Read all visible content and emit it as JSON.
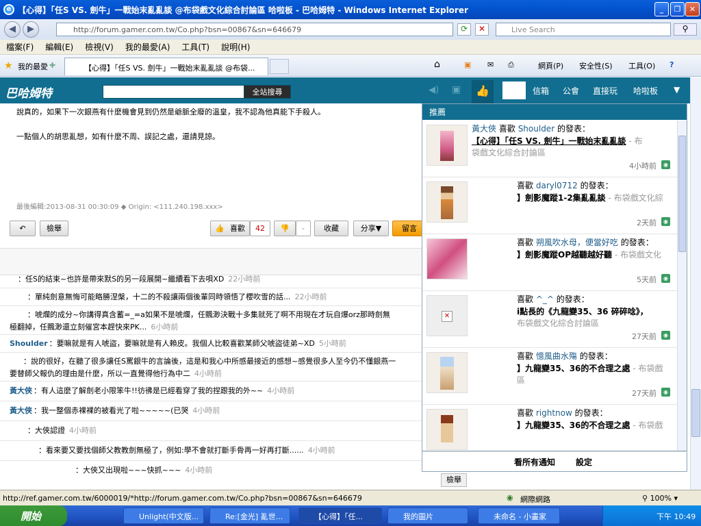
{
  "window": {
    "title": "【心得】「任S VS. 劍牛」一戰始末亂亂談 @布袋戲文化綜合討論區 哈啦板 - 巴哈姆特 - Windows Internet Explorer"
  },
  "address": {
    "url": "http://forum.gamer.com.tw/Co.php?bsn=00867&sn=646679",
    "search_placeholder": "Live Search"
  },
  "menu": [
    "檔案(F)",
    "編輯(E)",
    "檢視(V)",
    "我的最愛(A)",
    "工具(T)",
    "說明(H)"
  ],
  "favbar": {
    "favorites": "我的最愛",
    "tab_title": "【心得】「任S VS. 劍牛」一戰始末亂亂談 @布袋...",
    "tools": [
      "網頁(P)",
      "安全性(S)",
      "工具(O)"
    ]
  },
  "site": {
    "logo": "巴哈姆特",
    "search_btn": "全站搜尋",
    "nav": [
      "信箱",
      "公會",
      "直接玩",
      "哈啦板"
    ]
  },
  "post": {
    "line1": "說真的，如果下一次銀燕有什麼機會見到仍然是爺脈全廢的溫皇，我不認為他真能下手殺人。",
    "line2": "一點個人的胡思亂想，如有什麼不周、誤記之處，還請見諒。",
    "edit": "最後編輯:2013-08-31 00:30:09",
    "origin": "Origin: <111.240.198.xxx>",
    "report": "檢舉",
    "like": "喜歡",
    "like_count": "42",
    "dislike_count": "-",
    "collect": "收藏",
    "share": "分享▼",
    "comment": "留言"
  },
  "comments": [
    {
      "user": "",
      "text": "：任S的結束~也許是帶來默S的另一段展開~繼續看下去唄XD",
      "time": "22小時前"
    },
    {
      "user": "",
      "text": "：單純劍意無悔可能略勝涅槃，十二的不殺讓兩個後輩同時領悟了櫻吹雪的話...",
      "time": "22小時前"
    },
    {
      "user": "",
      "text": "：唬爛的成分~你講得真含蓄=_=a如果不是唬爛，任飄渺決戰十多集就死了啊不用現在才玩自爆orz那時劍無",
      "text2": "極翻掉，任飄渺還立刻催宮本趕快來PK...",
      "time": "6小時前"
    },
    {
      "user": "Shoulder",
      "text": "：要嘛就是有人唬盜，要嘛就是有人賴皮。我個人比較喜歡某師父唬盜徒弟~XD",
      "time": "5小時前"
    },
    {
      "user": "",
      "text": "：說的很好，在聽了很多讓任S罵銀牛的言論後，這是和我心中所感最接近的感想~感覺很多人至今仍不懂銀燕一",
      "text2": "要替師父報仇的理由是什麼，所以一直覺得他行為中二",
      "time": "4小時前"
    },
    {
      "user": "黃大俠",
      "text": "：有人這麼了解劍老小限笨牛!!彷彿是已經看穿了我的捏跟我的外~~",
      "time": "4小時前"
    },
    {
      "user": "黃大俠",
      "text": "：我一整個赤裸裸的被看光了啦~~~~~(已哭",
      "time": "4小時前"
    },
    {
      "user": "",
      "text": "：大俠認證",
      "time": "4小時前"
    },
    {
      "user": "",
      "text": "：看來要又要找個師父教教劍無極了，例如:學不會就打斷手骨再一好再打斷......",
      "time": "4小時前"
    },
    {
      "user": "",
      "text": "：大俠又出現啦~~~快抓~~~",
      "time": "4小時前"
    }
  ],
  "notifications": {
    "header": "推薦",
    "items": [
      {
        "user": "黃大俠",
        "verb": "喜歡",
        "target": "Shoulder",
        "suffix": "的發表：",
        "title": "【心得】「任S VS. 劍牛」一戰始末亂亂談",
        "board": "- 布",
        "board2": "袋戲文化綜合討論區",
        "time": "4小時前"
      },
      {
        "user": "",
        "verb": "喜歡",
        "target": "daryl0712",
        "suffix": "的發表：",
        "title": "】劍影魔蹤1-2集亂亂談",
        "board": "- 布袋戲文化綜",
        "board2": "",
        "time": "2天前"
      },
      {
        "user": "",
        "verb": "喜歡",
        "target": "朔風吹水母，便當好吃",
        "suffix": "的發表：",
        "title": "】劍影魔蹤OP越聽越好聽",
        "board": "- 布袋戲文化",
        "board2": "",
        "time": "5天前"
      },
      {
        "user": "",
        "verb": "喜歡",
        "target": "^_^",
        "suffix": "的發表：",
        "title": "i點長的《九龍變35、36 碎碎唸》，",
        "board": "",
        "board2": "布袋戲文化綜合討論區",
        "time": "27天前"
      },
      {
        "user": "",
        "verb": "喜歡",
        "target": "憶風曲水殤",
        "suffix": "的發表：",
        "title": "】九龍變35、36的不合理之處",
        "board": "- 布袋戲",
        "board2": "區",
        "time": "27天前"
      },
      {
        "user": "",
        "verb": "喜歡",
        "target": "rightnow",
        "suffix": "的發表：",
        "title": "】九龍變35、36的不合理之處",
        "board": "- 布袋戲",
        "board2": "",
        "time": ""
      }
    ],
    "see_all": "看所有通知",
    "settings": "設定"
  },
  "status": {
    "url": "http://ref.gamer.com.tw/6000019/*http://forum.gamer.com.tw/Co.php?bsn=00867&sn=646679",
    "zone": "網際網路",
    "zoom": "100%"
  },
  "taskbar": {
    "start": "開始",
    "tasks": [
      "Unlight(中文版...",
      "Re:[金光] 亂世...",
      "【心得】「任...",
      "我的圖片",
      "未命名 - 小畫家"
    ],
    "clock": "下午 10:49"
  }
}
